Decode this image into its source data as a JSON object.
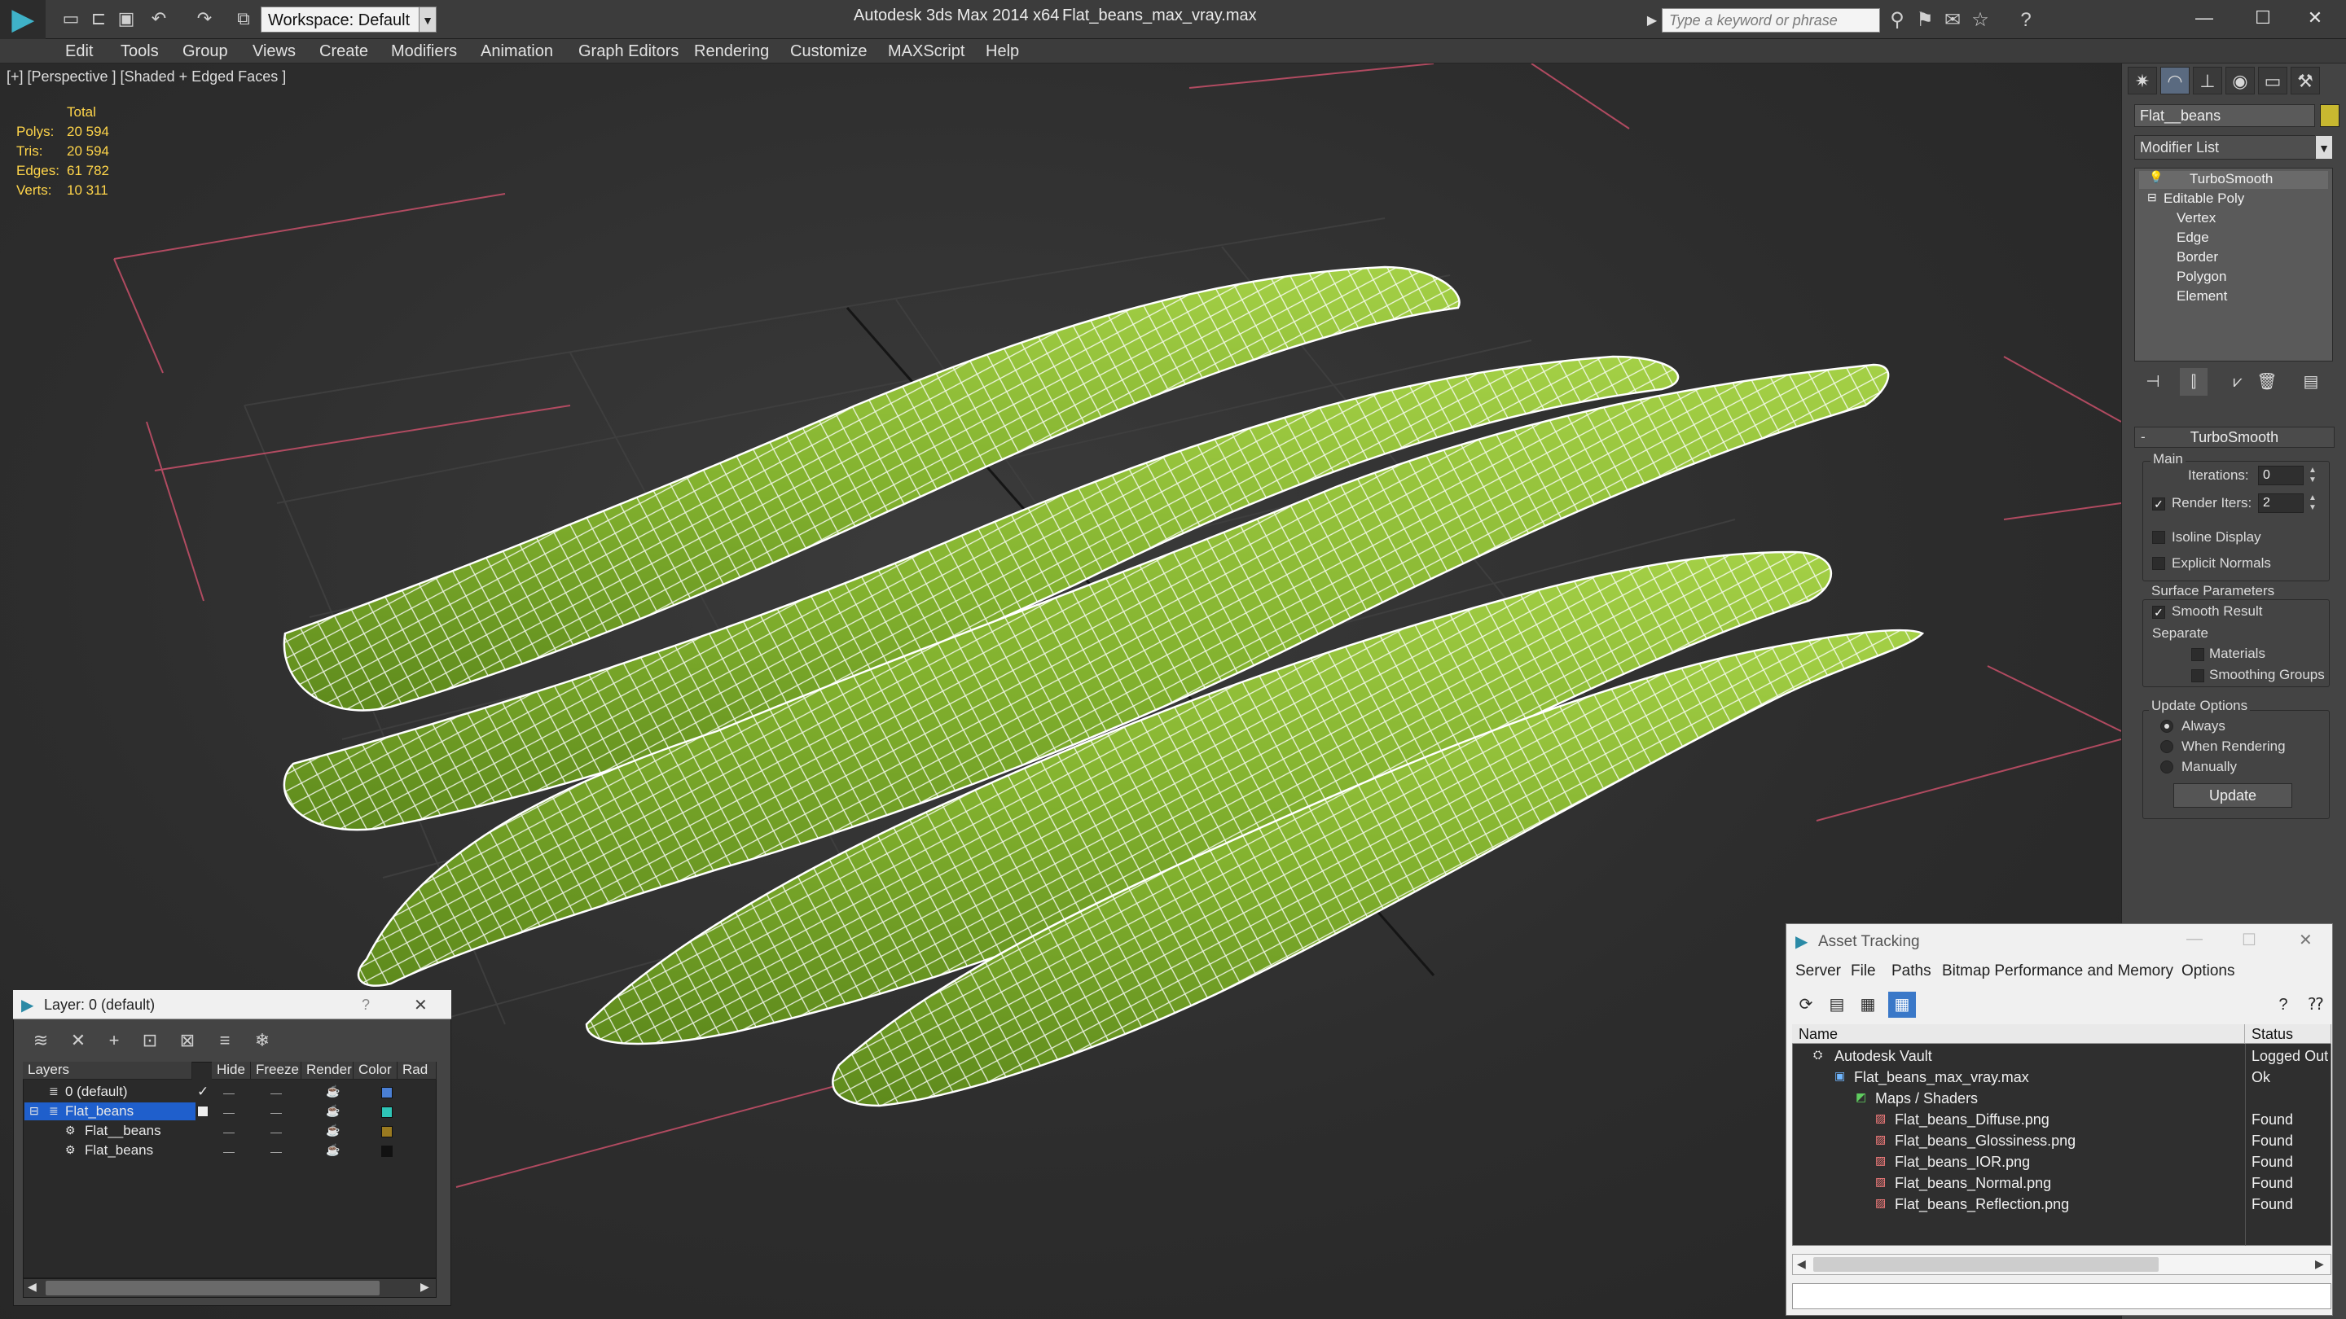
{
  "titlebar": {
    "workspace": "Workspace: Default",
    "app_title": "Autodesk 3ds Max  2014 x64",
    "file_title": "Flat_beans_max_vray.max",
    "search_placeholder": "Type a keyword or phrase"
  },
  "menu": [
    "Edit",
    "Tools",
    "Group",
    "Views",
    "Create",
    "Modifiers",
    "Animation",
    "Graph Editors",
    "Rendering",
    "Customize",
    "MAXScript",
    "Help"
  ],
  "viewport": {
    "label": "[+] [Perspective ] [Shaded + Edged Faces ]",
    "stats_header": "Total",
    "stats": [
      {
        "label": "Polys:",
        "value": "20 594"
      },
      {
        "label": "Tris:",
        "value": "20 594"
      },
      {
        "label": "Edges:",
        "value": "61 782"
      },
      {
        "label": "Verts:",
        "value": "10 311"
      }
    ]
  },
  "command_panel": {
    "object_name": "Flat__beans",
    "object_color": "#c8b830",
    "modifier_list": "Modifier List",
    "stack": [
      "TurboSmooth",
      "Editable Poly",
      "Vertex",
      "Edge",
      "Border",
      "Polygon",
      "Element"
    ],
    "rollout_title": "TurboSmooth",
    "main_group": "Main",
    "iterations_label": "Iterations:",
    "iterations_value": "0",
    "render_iters_label": "Render Iters:",
    "render_iters_value": "2",
    "isoline": "Isoline Display",
    "explicit": "Explicit Normals",
    "surface_group": "Surface Parameters",
    "smooth_result": "Smooth Result",
    "separate": "Separate",
    "materials": "Materials",
    "smoothing_groups": "Smoothing Groups",
    "update_group": "Update Options",
    "always": "Always",
    "when_rendering": "When Rendering",
    "manually": "Manually",
    "update_button": "Update"
  },
  "layer_window": {
    "title": "Layer: 0 (default)",
    "help": "?",
    "columns": [
      "Layers",
      "Hide",
      "Freeze",
      "Render",
      "Color",
      "Rad"
    ],
    "rows": [
      {
        "name": "0 (default)",
        "color": "#4a7fd4"
      },
      {
        "name": "Flat_beans",
        "color": "#2ec4b6"
      },
      {
        "name": "Flat__beans",
        "color": "#9a7a20"
      },
      {
        "name": "Flat_beans",
        "color": "#111111"
      }
    ]
  },
  "asset_window": {
    "title": "Asset Tracking",
    "menu": [
      "Server",
      "File",
      "Paths",
      "Bitmap Performance and Memory",
      "Options"
    ],
    "col_name": "Name",
    "col_status": "Status",
    "rows": [
      {
        "name": "Autodesk Vault",
        "status": "Logged Out"
      },
      {
        "name": "Flat_beans_max_vray.max",
        "status": "Ok"
      },
      {
        "name": "Maps / Shaders",
        "status": ""
      },
      {
        "name": "Flat_beans_Diffuse.png",
        "status": "Found"
      },
      {
        "name": "Flat_beans_Glossiness.png",
        "status": "Found"
      },
      {
        "name": "Flat_beans_IOR.png",
        "status": "Found"
      },
      {
        "name": "Flat_beans_Normal.png",
        "status": "Found"
      },
      {
        "name": "Flat_beans_Reflection.png",
        "status": "Found"
      }
    ]
  }
}
